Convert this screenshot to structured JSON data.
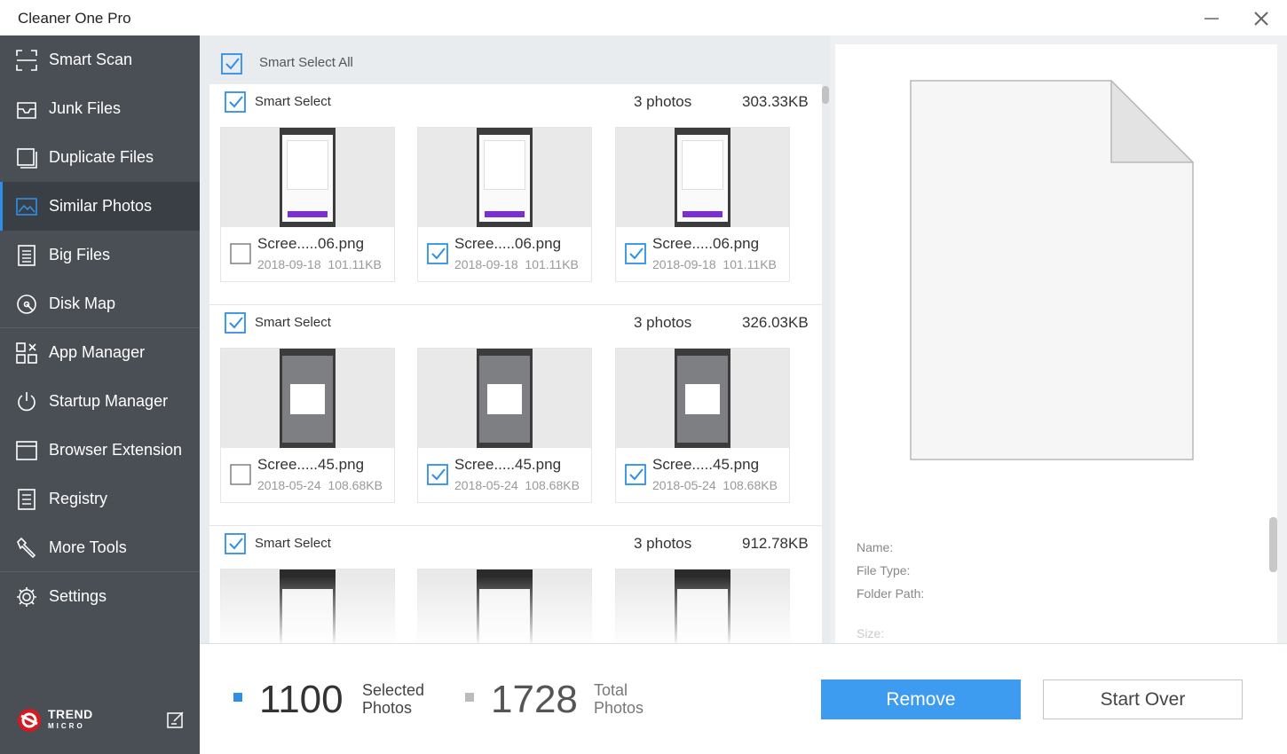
{
  "app": {
    "title": "Cleaner One Pro"
  },
  "sidebar": {
    "items": [
      {
        "label": "Smart Scan"
      },
      {
        "label": "Junk Files"
      },
      {
        "label": "Duplicate Files"
      },
      {
        "label": "Similar Photos"
      },
      {
        "label": "Big Files"
      },
      {
        "label": "Disk Map"
      },
      {
        "label": "App Manager"
      },
      {
        "label": "Startup Manager"
      },
      {
        "label": "Browser Extension"
      },
      {
        "label": "Registry"
      },
      {
        "label": "More Tools"
      },
      {
        "label": "Settings"
      }
    ],
    "active": "Similar Photos",
    "brand": {
      "line1": "TREND",
      "line2": "MICRO"
    }
  },
  "list": {
    "select_all_label": "Smart Select All",
    "groups": [
      {
        "label": "Smart Select",
        "count": "3 photos",
        "size": "303.33KB",
        "photos": [
          {
            "name": "Scree.....06.png",
            "date": "2018-09-18",
            "size": "101.11KB",
            "checked": false
          },
          {
            "name": "Scree.....06.png",
            "date": "2018-09-18",
            "size": "101.11KB",
            "checked": true
          },
          {
            "name": "Scree.....06.png",
            "date": "2018-09-18",
            "size": "101.11KB",
            "checked": true
          }
        ]
      },
      {
        "label": "Smart Select",
        "count": "3 photos",
        "size": "326.03KB",
        "photos": [
          {
            "name": "Scree.....45.png",
            "date": "2018-05-24",
            "size": "108.68KB",
            "checked": false
          },
          {
            "name": "Scree.....45.png",
            "date": "2018-05-24",
            "size": "108.68KB",
            "checked": true
          },
          {
            "name": "Scree.....45.png",
            "date": "2018-05-24",
            "size": "108.68KB",
            "checked": true
          }
        ]
      },
      {
        "label": "Smart Select",
        "count": "3 photos",
        "size": "912.78KB",
        "photos": [
          {},
          {},
          {}
        ]
      }
    ]
  },
  "preview": {
    "name_label": "Name:",
    "type_label": "File Type:",
    "path_label": "Folder Path:",
    "size_label": "Size:"
  },
  "footer": {
    "selected_count": "1100",
    "selected_label_1": "Selected",
    "selected_label_2": "Photos",
    "total_count": "1728",
    "total_label_1": "Total",
    "total_label_2": "Photos",
    "remove_label": "Remove",
    "start_over_label": "Start Over"
  },
  "colors": {
    "accent": "#3d9bf0",
    "sidebar_bg": "#4a4f55",
    "sidebar_active": "#3a3f45"
  }
}
